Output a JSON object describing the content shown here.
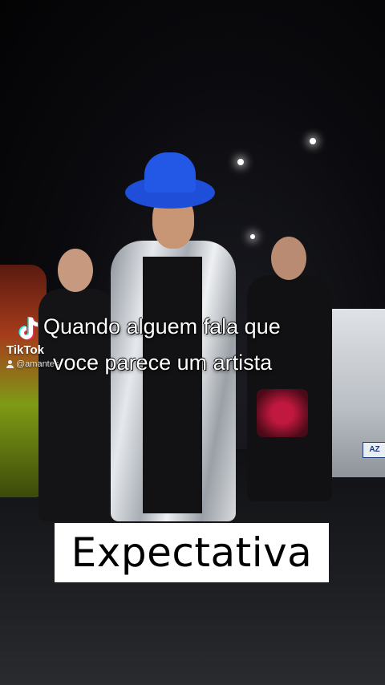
{
  "watermark": {
    "brand": "TikTok",
    "username": "@amantes",
    "icon": "tiktok-logo-icon"
  },
  "captions": {
    "line1": "Quando alguem fala que",
    "line2": "voce parece um artista"
  },
  "label": {
    "text": "Expectativa"
  },
  "scene": {
    "hat_color": "#2358e6",
    "plate_text": "AZ"
  }
}
